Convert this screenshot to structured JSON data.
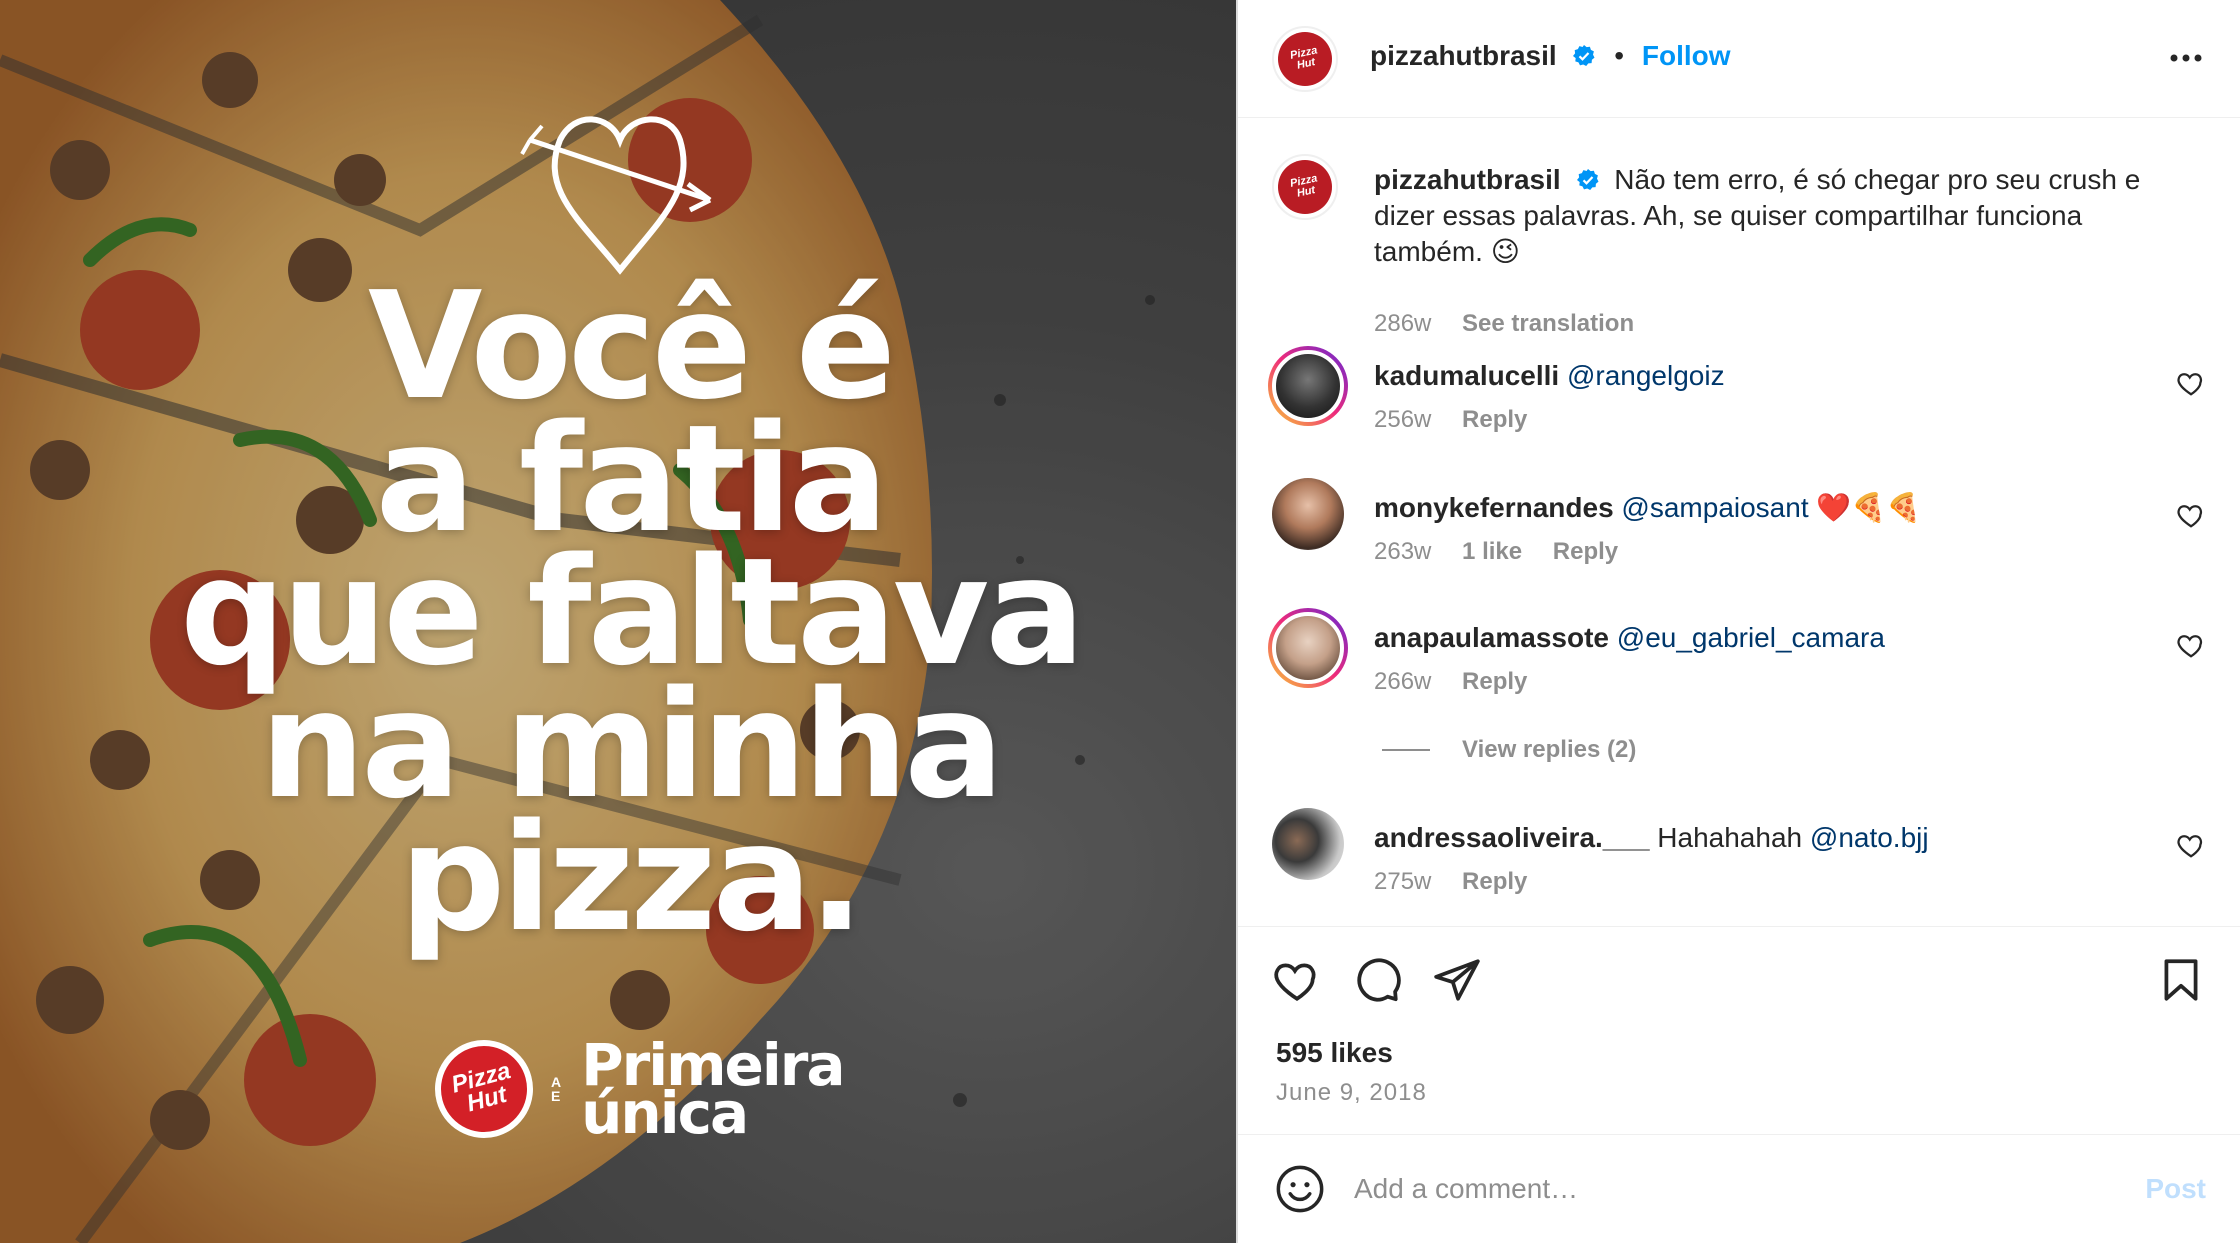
{
  "media": {
    "headline_lines": [
      "Você é",
      "a fatia",
      "que faltava",
      "na minha",
      "pizza."
    ],
    "brand_badge": "Pizza Hut",
    "tagline_small": [
      "A",
      "E"
    ],
    "tagline_big": [
      "Primeira",
      "única"
    ]
  },
  "header": {
    "username": "pizzahutbrasil",
    "separator": "•",
    "follow_label": "Follow"
  },
  "caption": {
    "username": "pizzahutbrasil",
    "text": "Não tem erro, é só chegar pro seu crush e dizer essas palavras. Ah, se quiser compartilhar funciona também. 😉",
    "time": "286w",
    "translate_label": "See translation"
  },
  "comments": [
    {
      "username": "kadumalucelli",
      "text": "",
      "mention": "@rangelgoiz",
      "time": "256w",
      "likes": "",
      "reply_label": "Reply"
    },
    {
      "username": "monykefernandes",
      "text": "",
      "mention": "@sampaiosant",
      "emoji": "❤️🍕🍕",
      "time": "263w",
      "likes": "1 like",
      "reply_label": "Reply"
    },
    {
      "username": "anapaulamassote",
      "text": "",
      "mention": "@eu_gabriel_camara",
      "time": "266w",
      "likes": "",
      "reply_label": "Reply",
      "view_replies": "View replies (2)"
    },
    {
      "username": "andressaoliveira.___",
      "text": "Hahahahah",
      "mention": "@nato.bjj",
      "time": "275w",
      "likes": "",
      "reply_label": "Reply"
    }
  ],
  "stats": {
    "likes": "595 likes",
    "date": "June 9, 2018"
  },
  "composer": {
    "placeholder": "Add a comment…",
    "post_label": "Post"
  },
  "colors": {
    "accent": "#0095f6",
    "mention": "#00376b",
    "muted": "#8e8e8e",
    "brand_red": "#d32027"
  }
}
